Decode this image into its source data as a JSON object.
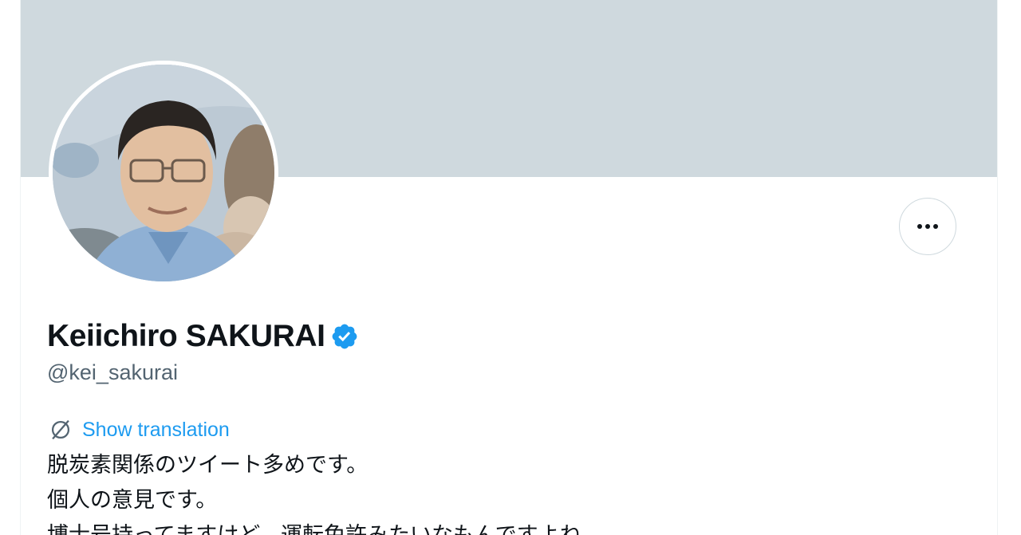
{
  "profile": {
    "display_name": "Keiichiro SAKURAI",
    "handle": "@kei_sakurai",
    "verified": true,
    "avatar_alt": "Profile photo",
    "show_translation_label": "Show translation",
    "bio_lines": [
      "脱炭素関係のツイート多めです。",
      "個人の意見です。",
      "博士号持ってますけど、運転免許みたいなもんですよね。"
    ]
  },
  "icons": {
    "more": "more-horizontal-icon",
    "verified": "verified-badge-icon",
    "translate": "translate-icon"
  },
  "colors": {
    "banner": "#cfd9de",
    "text_primary": "#0f1419",
    "text_secondary": "#536471",
    "accent": "#1d9bf0"
  }
}
